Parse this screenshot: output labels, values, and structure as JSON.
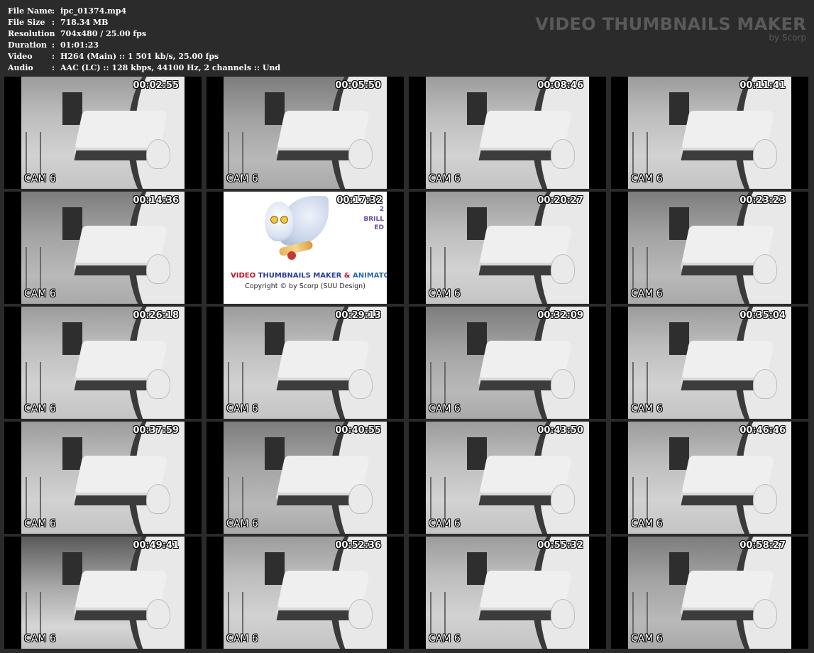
{
  "info": [
    {
      "key": "File Name",
      "value": "ipc_01374.mp4"
    },
    {
      "key": "File Size",
      "value": "718.34 MB"
    },
    {
      "key": "Resolution",
      "value": "704x480 / 25.00 fps"
    },
    {
      "key": "Duration",
      "value": "01:01:23"
    },
    {
      "key": "Video",
      "value": "H264 (Main) :: 1 501 kb/s, 25.00 fps"
    },
    {
      "key": "Audio",
      "value": "AAC (LC) :: 128 kbps, 44100 Hz, 2 channels :: Und"
    }
  ],
  "separator": ":",
  "brand": {
    "title": "VIDEO THUMBNAILS MAKER",
    "subtitle": "by Scorp"
  },
  "cam_label": "CAM 6",
  "thumbnails": [
    {
      "time": "00:02:55"
    },
    {
      "time": "00:05:50"
    },
    {
      "time": "00:08:46"
    },
    {
      "time": "00:11:41"
    },
    {
      "time": "00:14:36"
    },
    {
      "time": "00:17:32",
      "logo": true
    },
    {
      "time": "00:20:27"
    },
    {
      "time": "00:23:23"
    },
    {
      "time": "00:26:18"
    },
    {
      "time": "00:29:13"
    },
    {
      "time": "00:32:09"
    },
    {
      "time": "00:35:04"
    },
    {
      "time": "00:37:59"
    },
    {
      "time": "00:40:55"
    },
    {
      "time": "00:43:50"
    },
    {
      "time": "00:46:46"
    },
    {
      "time": "00:49:41"
    },
    {
      "time": "00:52:36"
    },
    {
      "time": "00:55:32"
    },
    {
      "time": "00:58:27"
    }
  ],
  "logo": {
    "title_part1": "VIDEO ",
    "title_part2": "THUMBNAILS MAKER",
    "title_part3": " & ",
    "title_part4": "ANIMATOR",
    "copyright": "Copyright © by Scorp (SUU Design)",
    "side_1": "2",
    "side_2": "BRILL",
    "side_3": "ED",
    "colors": {
      "part1": "#c0142a",
      "part2": "#2a3a9a",
      "part3": "#c0142a",
      "part4": "#2a6ab0"
    }
  }
}
